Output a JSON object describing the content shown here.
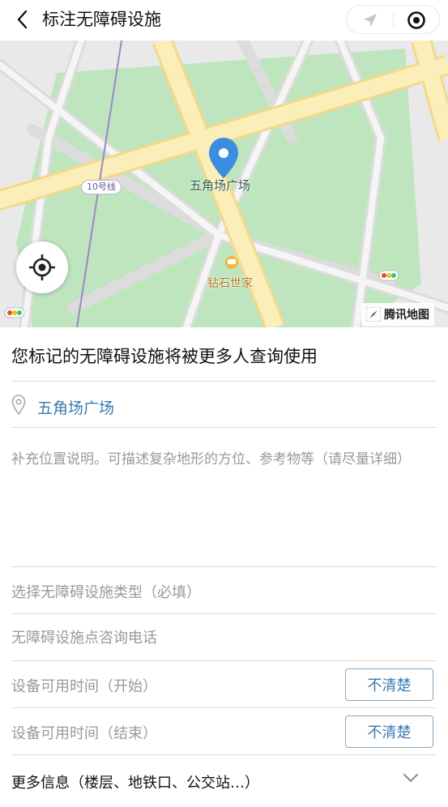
{
  "header": {
    "title": "标注无障碍设施",
    "icons": {
      "back": "back-chevron-icon",
      "location": "location-arrow-icon",
      "record": "record-icon"
    }
  },
  "map": {
    "poi_main": "五角场广场",
    "poi_secondary": "钻石世家",
    "metro_line": "10号线",
    "provider": "腾讯地图",
    "colors": {
      "park": "#bfe5bf",
      "major_road": "#fbe9a6",
      "road": "#dcdcdc",
      "marker": "#3b8edf",
      "metro": "#9a86c8"
    }
  },
  "form": {
    "heading": "您标记的无障碍设施将被更多人查询使用",
    "location_name": "五角场广场",
    "description_placeholder": "补充位置说明。可描述复杂地形的方位、参考物等（请尽量详细）",
    "facility_type_label": "选择无障碍设施类型（必填）",
    "phone_placeholder": "无障碍设施点咨询电话",
    "start_time_label": "设备可用时间（开始）",
    "end_time_label": "设备可用时间（结束）",
    "unsure_label": "不清楚",
    "more_info_label": "更多信息（楼层、地铁口、公交站…）"
  },
  "accent_color": "#3a7ab0"
}
